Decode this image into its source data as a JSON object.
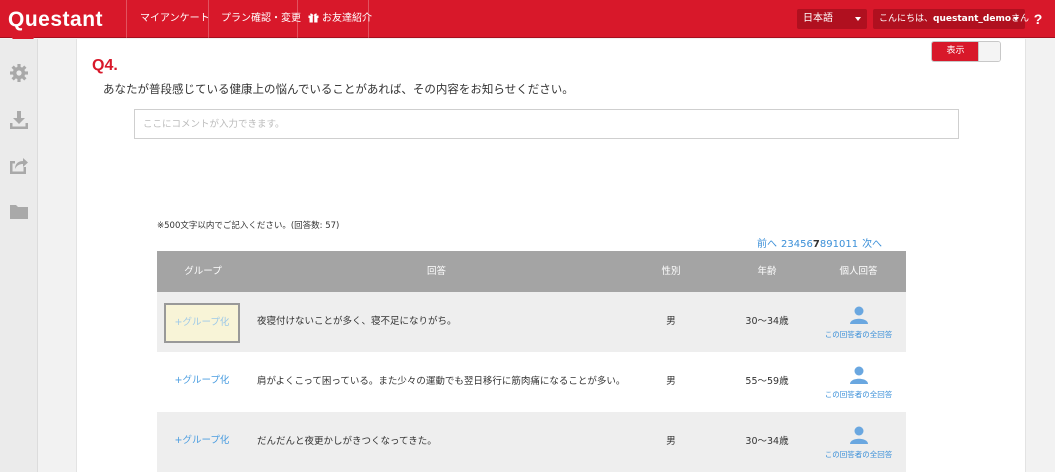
{
  "header": {
    "logo_text": "Questant",
    "nav": [
      {
        "label": "マイアンケート"
      },
      {
        "label": "プラン確認・変更"
      },
      {
        "label": "お友達紹介"
      }
    ],
    "language": "日本語",
    "greeting_prefix": "こんにちは、",
    "username": "questant_demo",
    "greeting_suffix": "さん",
    "help_label": "?"
  },
  "sidebar": {
    "icons": [
      "gear-icon",
      "download-icon",
      "export-icon",
      "folder-icon"
    ]
  },
  "toggle": {
    "label": "表示",
    "state": "on"
  },
  "question": {
    "number": "Q4.",
    "text": "あなたが普段感じている健康上の悩んでいることがあれば、その内容をお知らせください。"
  },
  "comment": {
    "placeholder": "ここにコメントが入力できます。",
    "value": ""
  },
  "note": "※500文字以内でご記入ください。(回答数: 57)",
  "pagination": {
    "prev": "前へ",
    "pages": [
      "2",
      "3",
      "4",
      "5",
      "6",
      "7",
      "8",
      "9",
      "10",
      "11"
    ],
    "current": "7",
    "next": "次へ"
  },
  "table": {
    "headers": {
      "group": "グループ",
      "answer": "回答",
      "gender": "性別",
      "age": "年齢",
      "individual": "個人回答"
    },
    "rows": [
      {
        "group_label": "+グループ化",
        "answer": "夜寝付けないことが多く、寝不足になりがち。",
        "gender": "男",
        "age": "30〜34歳",
        "individual_label": "この回答者の全回答",
        "highlighted": true
      },
      {
        "group_label": "+グループ化",
        "answer": "肩がよくこって困っている。また少々の運動でも翌日移行に筋肉痛になることが多い。",
        "gender": "男",
        "age": "55〜59歳",
        "individual_label": "この回答者の全回答",
        "highlighted": false
      },
      {
        "group_label": "+グループ化",
        "answer": "だんだんと夜更かしがきつくなってきた。",
        "gender": "男",
        "age": "30〜34歳",
        "individual_label": "この回答者の全回答",
        "highlighted": false
      }
    ]
  },
  "colors": {
    "brand_red": "#d8182a",
    "link_blue": "#3a8fd8",
    "header_gray": "#a4a4a4",
    "row_shade": "#eeeeee"
  }
}
